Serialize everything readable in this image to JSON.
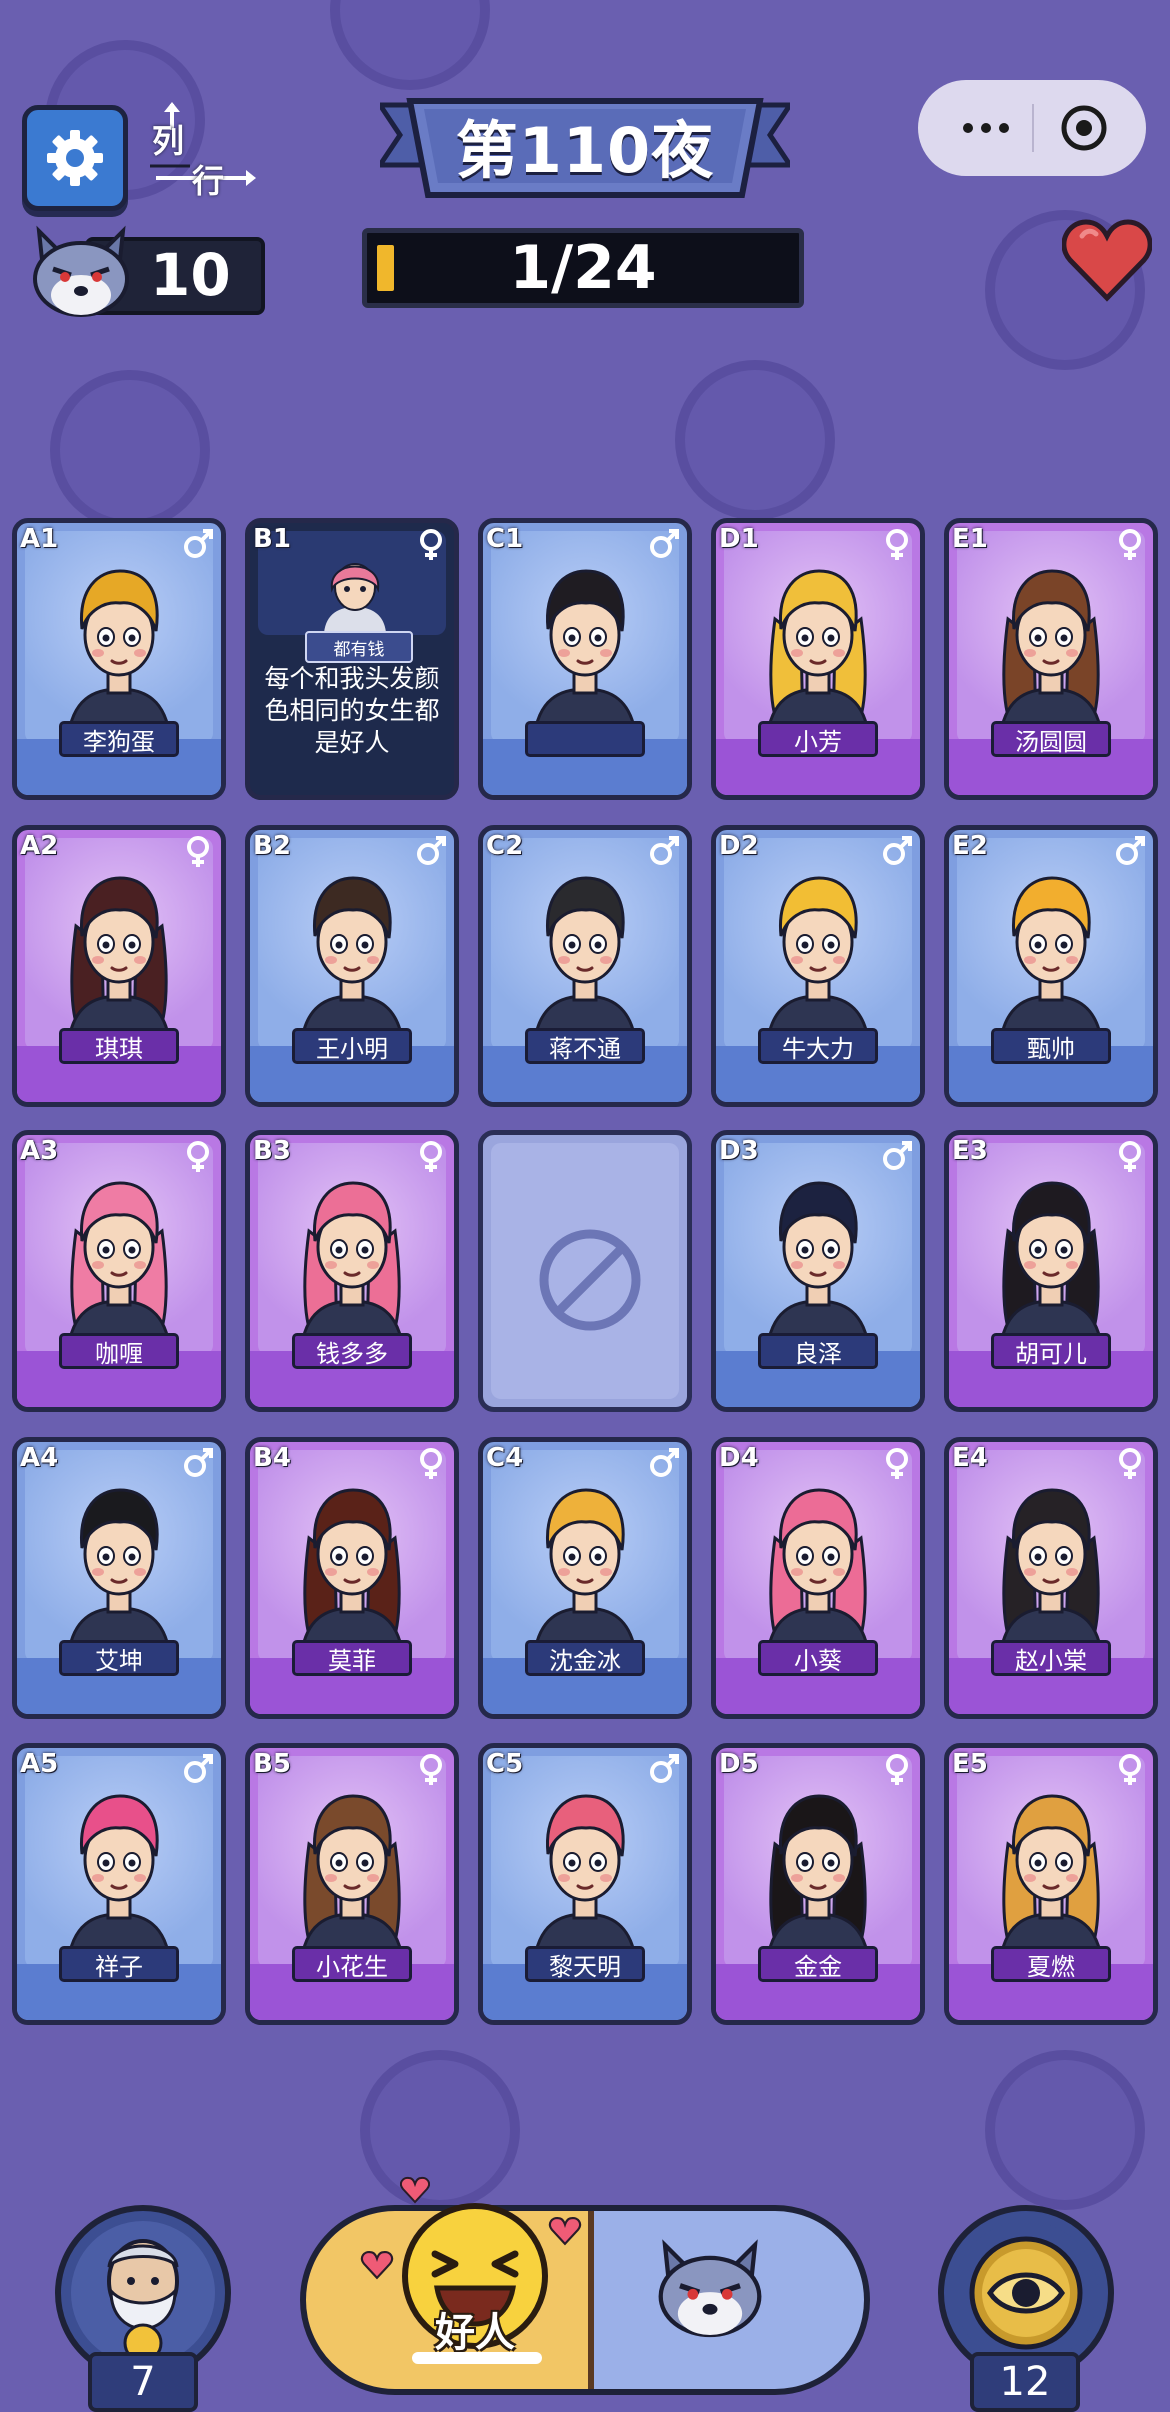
{
  "header": {
    "title": "第110夜",
    "layout_toggle": {
      "col_label": "列",
      "row_label": "行"
    },
    "wolf_count": "10",
    "progress": {
      "text": "1/24",
      "current": 1,
      "total": 24
    }
  },
  "icons": {
    "settings": "gear-icon",
    "more": "more-dots-icon",
    "close": "target-circle-icon",
    "lives": "heart-icon",
    "wolf": "wolf-face-icon",
    "male": "male-symbol-icon",
    "female": "female-symbol-icon",
    "blocked": "blocked-cell-icon",
    "good": "laughing-emoji-icon",
    "hint": "old-man-icon",
    "eye": "eye-icon"
  },
  "cards": [
    {
      "id": "A1",
      "name": "李狗蛋",
      "gender": "male",
      "hair": "#e6a826"
    },
    {
      "id": "B1",
      "gender": "female",
      "revealed": true,
      "role": "都有钱",
      "clue": "每个和我头发颜色相同的女生都是好人",
      "hair": "#e9799a"
    },
    {
      "id": "C1",
      "name": "",
      "gender": "male",
      "hair": "#1f1c22"
    },
    {
      "id": "D1",
      "name": "小芳",
      "gender": "female",
      "hair": "#f0bf3a"
    },
    {
      "id": "E1",
      "name": "汤圆圆",
      "gender": "female",
      "hair": "#7a4428"
    },
    {
      "id": "A2",
      "name": "琪琪",
      "gender": "female",
      "hair": "#4a2022"
    },
    {
      "id": "B2",
      "name": "王小明",
      "gender": "male",
      "hair": "#3d2a22"
    },
    {
      "id": "C2",
      "name": "蒋不通",
      "gender": "male",
      "hair": "#2a2a2e"
    },
    {
      "id": "D2",
      "name": "牛大力",
      "gender": "male",
      "hair": "#f2be34"
    },
    {
      "id": "E2",
      "name": "甄帅",
      "gender": "male",
      "hair": "#f2ae2e"
    },
    {
      "id": "A3",
      "name": "咖喱",
      "gender": "female",
      "hair": "#ef7ca4"
    },
    {
      "id": "B3",
      "name": "钱多多",
      "gender": "female",
      "hair": "#ec6f96"
    },
    {
      "id": "C3",
      "empty": true
    },
    {
      "id": "D3",
      "name": "良泽",
      "gender": "male",
      "hair": "#1c2240"
    },
    {
      "id": "E3",
      "name": "胡可儿",
      "gender": "female",
      "hair": "#1e1a20"
    },
    {
      "id": "A4",
      "name": "艾坤",
      "gender": "male",
      "hair": "#1a1a1e"
    },
    {
      "id": "B4",
      "name": "莫菲",
      "gender": "female",
      "hair": "#5a2218"
    },
    {
      "id": "C4",
      "name": "沈金冰",
      "gender": "male",
      "hair": "#eeb13a"
    },
    {
      "id": "D4",
      "name": "小葵",
      "gender": "female",
      "hair": "#ec6c96"
    },
    {
      "id": "E4",
      "name": "赵小棠",
      "gender": "female",
      "hair": "#262226"
    },
    {
      "id": "A5",
      "name": "祥子",
      "gender": "male",
      "hair": "#e8508a"
    },
    {
      "id": "B5",
      "name": "小花生",
      "gender": "female",
      "hair": "#7a4a2c"
    },
    {
      "id": "C5",
      "name": "黎天明",
      "gender": "male",
      "hair": "#e8607c"
    },
    {
      "id": "D5",
      "name": "金金",
      "gender": "female",
      "hair": "#1a1618"
    },
    {
      "id": "E5",
      "name": "夏燃",
      "gender": "female",
      "hair": "#e0a040"
    }
  ],
  "bottom": {
    "hint_count": "7",
    "good_label": "好人",
    "eye_count": "12"
  },
  "colors": {
    "background": "#6a5fb0",
    "male_card": "#7f9ee0",
    "female_card": "#b978e4",
    "progress_fill": "#f0b72c",
    "heart": "#d94848"
  }
}
